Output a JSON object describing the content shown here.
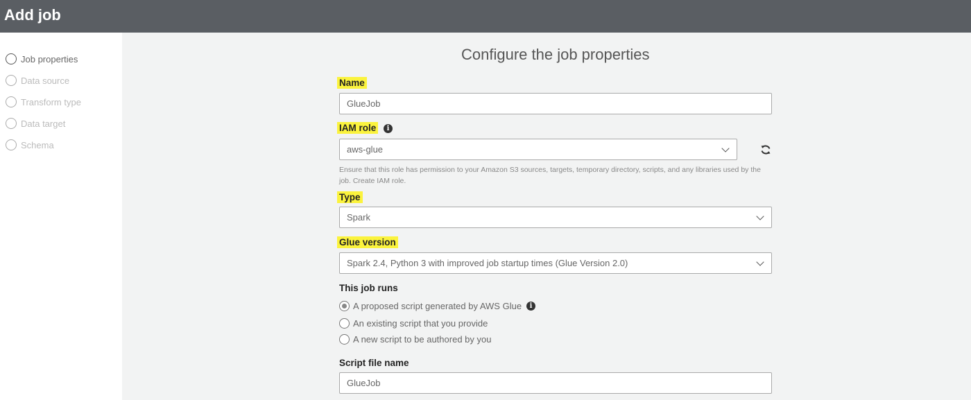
{
  "header": {
    "title": "Add job"
  },
  "sidebar": {
    "steps": [
      {
        "label": "Job properties"
      },
      {
        "label": "Data source"
      },
      {
        "label": "Transform type"
      },
      {
        "label": "Data target"
      },
      {
        "label": "Schema"
      }
    ]
  },
  "main": {
    "title": "Configure the job properties",
    "name": {
      "label": "Name",
      "value": "GlueJob"
    },
    "iam_role": {
      "label": "IAM role",
      "value": "aws-glue",
      "help": "Ensure that this role has permission to your Amazon S3 sources, targets, temporary directory, scripts, and any libraries used by the job. Create IAM role."
    },
    "type": {
      "label": "Type",
      "value": "Spark"
    },
    "glue_version": {
      "label": "Glue version",
      "value": "Spark 2.4, Python 3 with improved job startup times (Glue Version 2.0)"
    },
    "job_runs": {
      "label": "This job runs",
      "options": [
        {
          "label": "A proposed script generated by AWS Glue",
          "checked": true
        },
        {
          "label": "An existing script that you provide",
          "checked": false
        },
        {
          "label": "A new script to be authored by you",
          "checked": false
        }
      ]
    },
    "script_file_name": {
      "label": "Script file name",
      "value": "GlueJob"
    }
  },
  "icons": {
    "info": "info-icon",
    "refresh": "refresh-icon",
    "chevron": "chevron-down-icon"
  },
  "colors": {
    "header_bg": "#5a5e63",
    "highlight": "#fbf33d",
    "main_bg": "#f2f3f3"
  }
}
